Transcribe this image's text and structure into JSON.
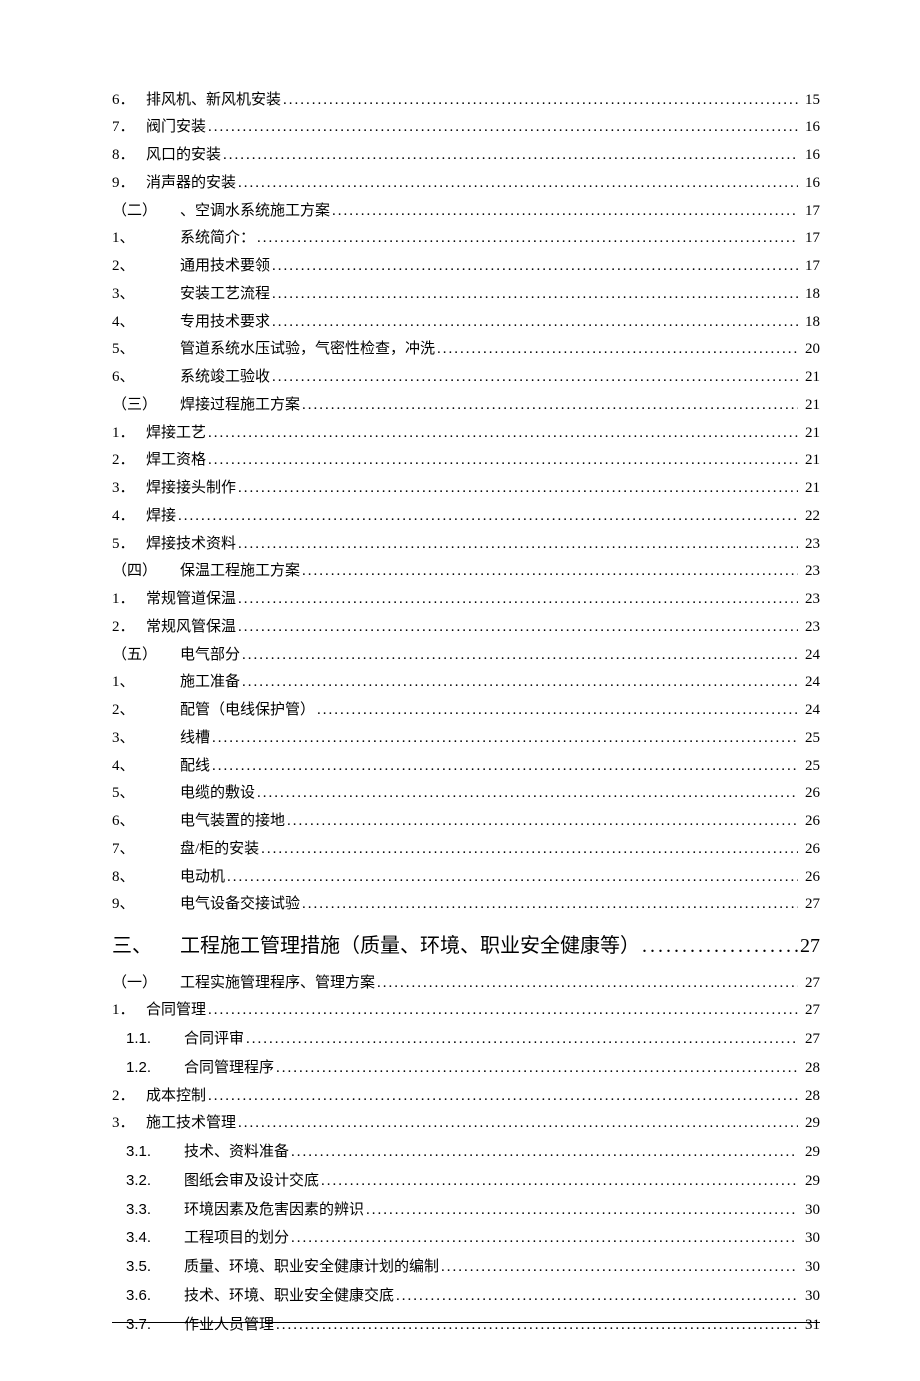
{
  "entries": [
    {
      "num": "6．",
      "title": "排风机、新风机安装",
      "page": "15",
      "cls": "narrow"
    },
    {
      "num": "7．",
      "title": "阀门安装",
      "page": "16",
      "cls": "narrow"
    },
    {
      "num": "8．",
      "title": "风口的安装",
      "page": "16",
      "cls": "narrow"
    },
    {
      "num": "9．",
      "title": "消声器的安装",
      "page": "16",
      "cls": "narrow"
    },
    {
      "num": "（二）",
      "title": "、空调水系统施工方案",
      "page": "17"
    },
    {
      "num": "1、",
      "title": "系统简介：",
      "page": "17"
    },
    {
      "num": "2、",
      "title": "通用技术要领",
      "page": "17"
    },
    {
      "num": "3、",
      "title": "安装工艺流程",
      "page": "18"
    },
    {
      "num": "4、",
      "title": "专用技术要求",
      "page": "18"
    },
    {
      "num": "5、",
      "title": "管道系统水压试验，气密性检查，冲洗",
      "page": "20"
    },
    {
      "num": "6、",
      "title": "系统竣工验收",
      "page": "21"
    },
    {
      "num": "（三）",
      "title": "焊接过程施工方案",
      "page": "21"
    },
    {
      "num": "1．",
      "title": "焊接工艺",
      "page": "21",
      "cls": "narrow"
    },
    {
      "num": "2．",
      "title": "焊工资格",
      "page": "21",
      "cls": "narrow"
    },
    {
      "num": "3．",
      "title": "焊接接头制作",
      "page": "21",
      "cls": "narrow"
    },
    {
      "num": "4．",
      "title": "焊接",
      "page": "22",
      "cls": "narrow"
    },
    {
      "num": "5．",
      "title": "焊接技术资料",
      "page": "23",
      "cls": "narrow"
    },
    {
      "num": "（四）",
      "title": "保温工程施工方案",
      "page": "23"
    },
    {
      "num": "1．",
      "title": "常规管道保温",
      "page": "23",
      "cls": "narrow"
    },
    {
      "num": "2．",
      "title": "常规风管保温",
      "page": "23",
      "cls": "narrow"
    },
    {
      "num": "（五）",
      "title": "电气部分",
      "page": "24"
    },
    {
      "num": "1、",
      "title": "施工准备",
      "page": "24"
    },
    {
      "num": "2、",
      "title": "配管（电线保护管）",
      "page": "24"
    },
    {
      "num": "3、",
      "title": "线槽",
      "page": "25"
    },
    {
      "num": "4、",
      "title": "配线",
      "page": "25"
    },
    {
      "num": "5、",
      "title": "电缆的敷设",
      "page": "26"
    },
    {
      "num": "6、",
      "title": "电气装置的接地",
      "page": "26"
    },
    {
      "num": "7、",
      "title": "盘/柜的安装",
      "page": "26"
    },
    {
      "num": "8、",
      "title": "电动机",
      "page": "26"
    },
    {
      "num": "9、",
      "title": "电气设备交接试验",
      "page": "27"
    }
  ],
  "section_head": {
    "num": "三、",
    "title": "工程施工管理措施（质量、环境、职业安全健康等）",
    "page": "27"
  },
  "entries2": [
    {
      "num": "（一）",
      "title": "工程实施管理程序、管理方案",
      "page": "27"
    },
    {
      "num": "1．",
      "title": "合同管理",
      "page": "27",
      "cls": "narrow"
    },
    {
      "num": "1.1.",
      "title": "合同评审",
      "page": "27",
      "cls": "indent",
      "bold": true
    },
    {
      "num": "1.2.",
      "title": "合同管理程序",
      "page": "28",
      "cls": "indent",
      "bold": true
    },
    {
      "num": "2．",
      "title": "成本控制",
      "page": "28",
      "cls": "narrow"
    },
    {
      "num": "3．",
      "title": "施工技术管理",
      "page": "29",
      "cls": "narrow"
    },
    {
      "num": "3.1.",
      "title": "技术、资料准备",
      "page": "29",
      "cls": "indent",
      "bold": true
    },
    {
      "num": "3.2.",
      "title": "图纸会审及设计交底",
      "page": "29",
      "cls": "indent",
      "bold": true
    },
    {
      "num": "3.3.",
      "title": "环境因素及危害因素的辨识",
      "page": "30",
      "cls": "indent",
      "bold": true
    },
    {
      "num": "3.4.",
      "title": "工程项目的划分",
      "page": "30",
      "cls": "indent",
      "bold": true
    },
    {
      "num": "3.5.",
      "title": "质量、环境、职业安全健康计划的编制",
      "page": "30",
      "cls": "indent",
      "bold": true
    },
    {
      "num": "3.6.",
      "title": "技术、环境、职业安全健康交底",
      "page": "30",
      "cls": "indent",
      "bold": true
    },
    {
      "num": "3.7.",
      "title": "作业人员管理",
      "page": "31",
      "cls": "indent",
      "bold": true
    }
  ]
}
